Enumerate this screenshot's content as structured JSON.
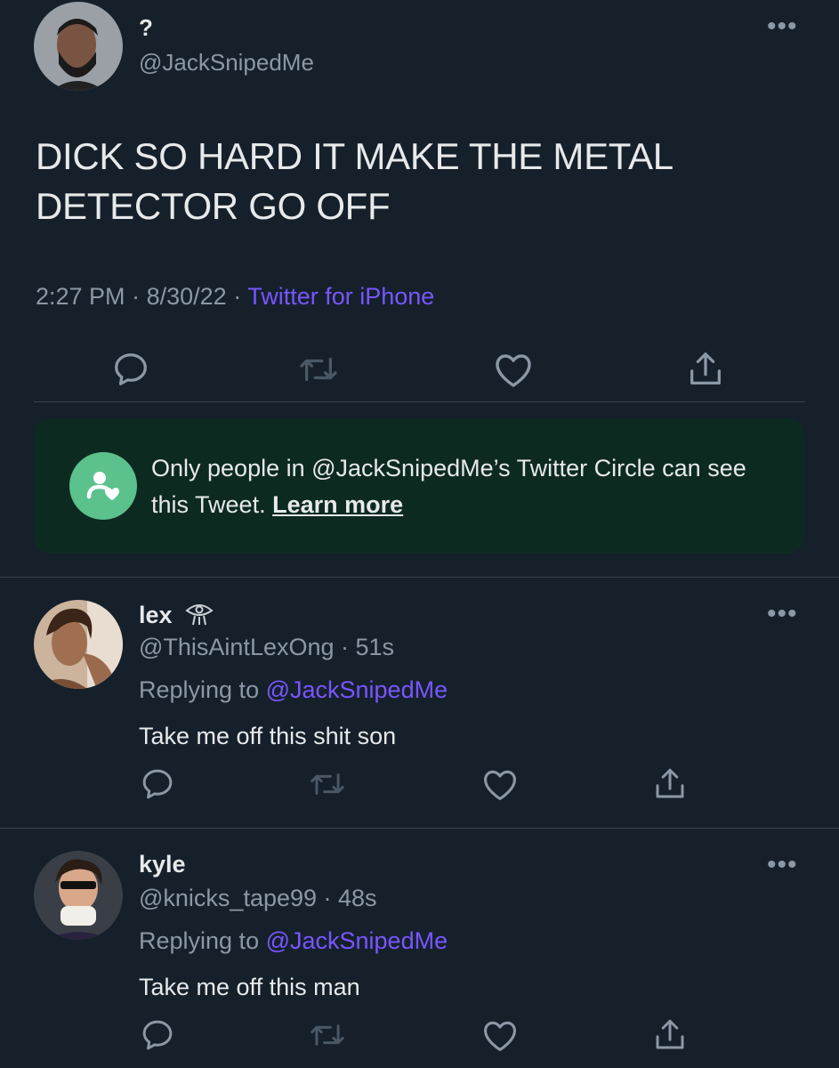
{
  "main_tweet": {
    "display_name": "?",
    "handle": "@JackSnipedMe",
    "text": "DICK SO HARD IT MAKE THE METAL DETECTOR GO OFF",
    "time": "2:27 PM",
    "date": "8/30/22",
    "sep": "·",
    "source": "Twitter for iPhone",
    "more": "•••"
  },
  "circle_notice": {
    "text": "Only people in @JackSnipedMe’s Twitter Circle can see this Tweet.",
    "link": "Learn more"
  },
  "replies": [
    {
      "name": "lex",
      "handle": "@ThisAintLexOng · 51s",
      "replying_prefix": "Replying to ",
      "replying_to": "@JackSnipedMe",
      "text": "Take me off this shit son",
      "more": "•••"
    },
    {
      "name": "kyle",
      "handle": "@knicks_tape99 · 48s",
      "replying_prefix": "Replying to ",
      "replying_to": "@JackSnipedMe",
      "text": "Take me off this man",
      "more": "•••"
    }
  ],
  "colors": {
    "background": "#15202b",
    "accent": "#7856ff",
    "muted": "#8b98a5",
    "circle_bg": "#0d2a21",
    "circle_icon": "#5bc18d"
  },
  "icons": [
    "reply-icon",
    "retweet-icon",
    "like-icon",
    "share-icon",
    "more-icon",
    "circle-icon"
  ]
}
